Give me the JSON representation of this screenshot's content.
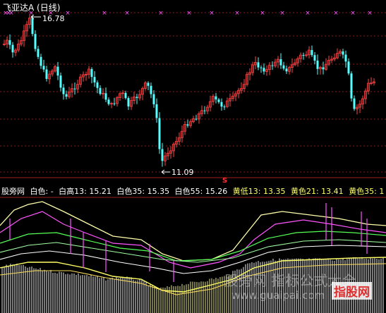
{
  "header": {
    "title": "飞亚达A (日线)"
  },
  "price_labels": {
    "high": "16.78",
    "low": "11.09"
  },
  "indicator_bar": {
    "name": "股旁网",
    "items": [
      {
        "text": "白色: -",
        "color": "#ffffff"
      },
      {
        "text": "白高13: 15.21",
        "color": "#ffffff"
      },
      {
        "text": "白色35: 15.35",
        "color": "#ffffff"
      },
      {
        "text": "白色55: 15.26",
        "color": "#ffffff"
      },
      {
        "text": "黄低13: 13.35",
        "color": "#ffff66"
      },
      {
        "text": "黄色21: 13.41",
        "color": "#ffff66"
      },
      {
        "text": "黄色35: 1",
        "color": "#ffff66"
      }
    ]
  },
  "signal_marker": "S",
  "watermark": {
    "main": "股旁网 指标公式大全",
    "url": "www.guaipai.com",
    "logo": "指股网"
  },
  "colors": {
    "up": "#ff4444",
    "down": "#55ffff",
    "grid": "#8b1a1a",
    "magenta": "#ff55ff",
    "green": "#55ff55",
    "yellow": "#ffff66"
  }
}
